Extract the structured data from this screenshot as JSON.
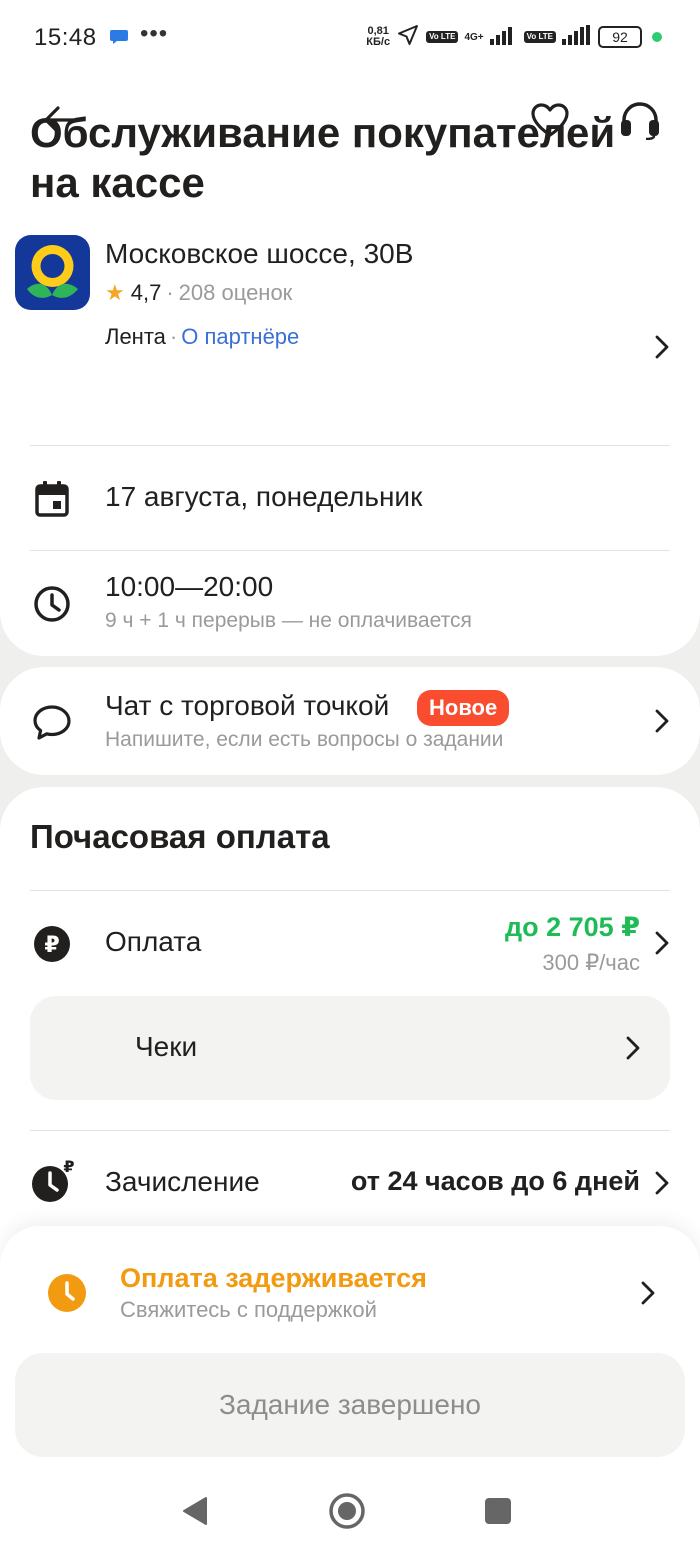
{
  "status_bar": {
    "time": "15:48",
    "dots": "•••",
    "speed_top": "0,81",
    "speed_bottom": "КБ/с",
    "volte": "Vo LTE",
    "net": "4G+",
    "battery": "92"
  },
  "header": {
    "title": "Обслуживание покупателей на кассе"
  },
  "store": {
    "address": "Московское шоссе, 30В",
    "rating": "4,7",
    "rating_count": "208 оценок",
    "brand": "Лента",
    "partner_link": "О партнёре"
  },
  "date": {
    "text": "17 августа, понедельник"
  },
  "time": {
    "range": "10:00—20:00",
    "details": "9 ч + 1 ч перерыв — не оплачивается"
  },
  "chat": {
    "title": "Чат с торговой точкой",
    "badge": "Новое",
    "subtitle": "Напишите, если есть вопросы о задании"
  },
  "payment": {
    "section_title": "Почасовая оплата",
    "label": "Оплата",
    "amount": "до 2 705 ₽",
    "rate": "300 ₽/час",
    "checks_label": "Чеки",
    "credit_label": "Зачисление",
    "credit_value": "от 24 часов до 6 дней"
  },
  "warning": {
    "title": "Оплата задерживается",
    "subtitle": "Свяжитесь с поддержкой"
  },
  "footer": {
    "button_label": "Задание завершено"
  },
  "colors": {
    "accent_green": "#1fbb57",
    "warning_orange": "#f29a10",
    "badge_red": "#fa4c2f",
    "link_blue": "#3a6fd8"
  }
}
